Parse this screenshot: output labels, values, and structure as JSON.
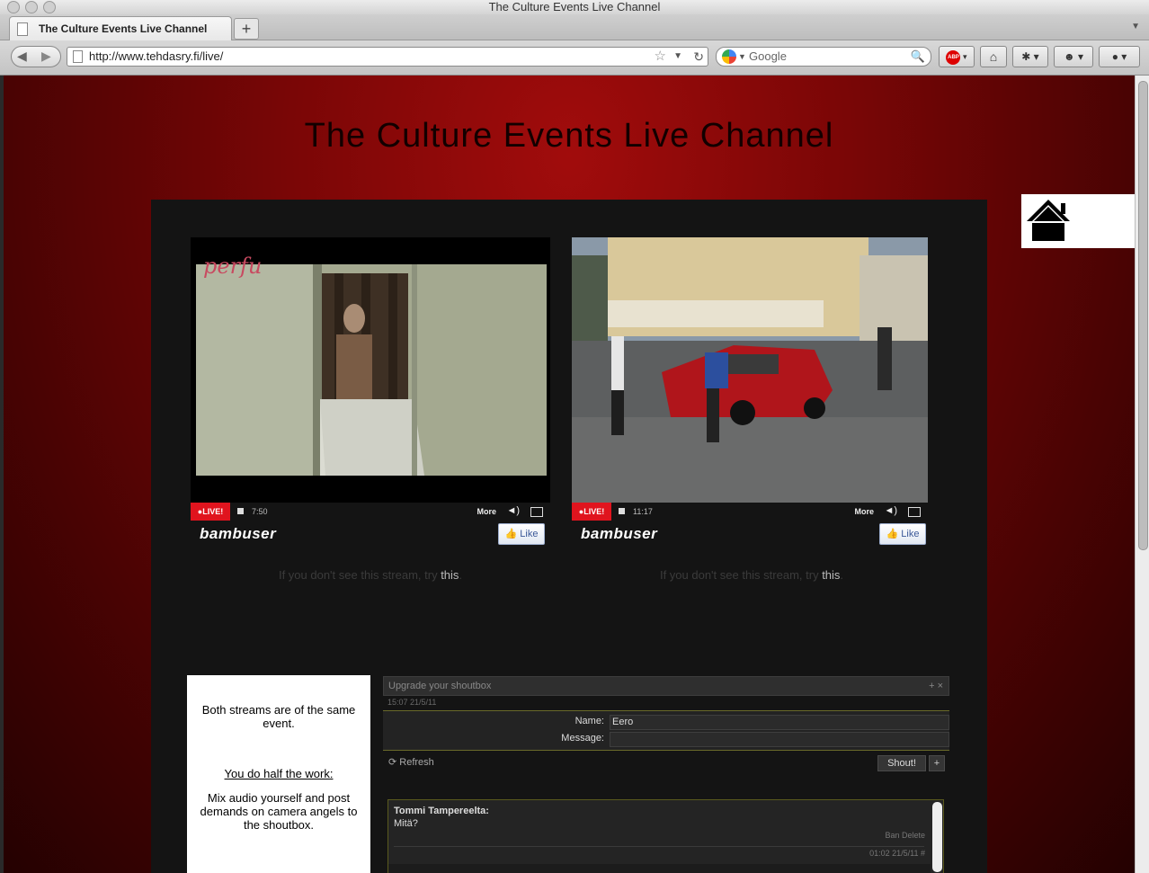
{
  "window": {
    "title": "The Culture Events Live Channel"
  },
  "tab": {
    "label": "The Culture Events Live Channel",
    "new_tab": "+"
  },
  "toolbar": {
    "url": "http://www.tehdasry.fi/live/",
    "search_placeholder": "Google",
    "abp_label": "ABP"
  },
  "page": {
    "title": "The Culture Events Live Channel",
    "streams": [
      {
        "live": "●LIVE!",
        "time": "7:50",
        "more": "More",
        "brand": "bambuser",
        "like": "Like",
        "fallback_prefix": "If you don't see this stream, try ",
        "fallback_link": "this",
        "fallback_suffix": "."
      },
      {
        "live": "●LIVE!",
        "time": "11:17",
        "more": "More",
        "brand": "bambuser",
        "like": "Like",
        "fallback_prefix": "If you don't see this stream, try ",
        "fallback_link": "this",
        "fallback_suffix": "."
      }
    ],
    "info": {
      "p1": "Both streams are of the same event.",
      "heading": "You do half the work:",
      "p2": "Mix audio yourself and post demands on camera angels to the shoutbox."
    }
  },
  "shoutbox": {
    "header": "Upgrade your shoutbox",
    "header_controls": "+ ×",
    "timestamp": "15:07 21/5/11",
    "name_label": "Name:",
    "name_value": "Eero",
    "message_label": "Message:",
    "message_value": "",
    "refresh": "Refresh",
    "shout": "Shout!",
    "plus": "+",
    "messages": [
      {
        "name": "Tommi Tampereelta:",
        "text": "Mitä?",
        "actions": "Ban Delete",
        "time": "01:02 21/5/11 #"
      }
    ]
  },
  "colors": {
    "live_red": "#e0141e",
    "page_red": "#7a0606",
    "panel": "#141414"
  }
}
